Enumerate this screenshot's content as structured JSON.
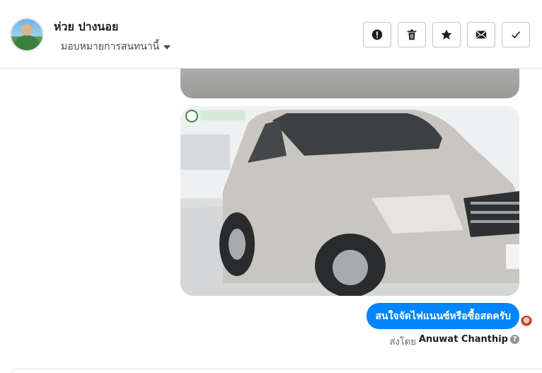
{
  "header": {
    "contact_name": "ห่วย ปางนอย",
    "assign_label": "มอบหมายการสนทนานี้"
  },
  "toolbar": {
    "icons": [
      "alert-icon",
      "trash-icon",
      "star-icon",
      "mail-icon",
      "check-icon"
    ]
  },
  "thread": {
    "message_text": "สนใจจัดไฟแนนซ์หรือซื้อสดครับ",
    "sent_by_prefix": "ส่งโดย",
    "sent_by_name": "Anuwat Chanthip",
    "help_glyph": "?"
  },
  "colors": {
    "bubble": "#0084ff",
    "border": "#bec3c9"
  }
}
